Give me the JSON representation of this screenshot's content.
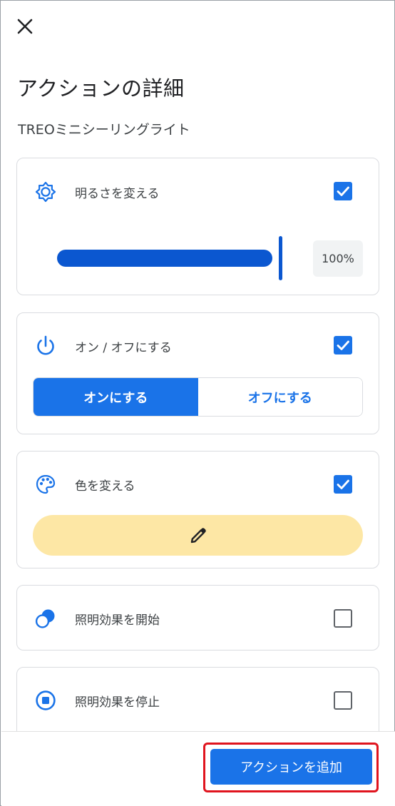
{
  "header": {
    "close_icon": "close-icon",
    "title": "アクションの詳細",
    "device": "TREOミニシーリングライト"
  },
  "actions": {
    "brightness": {
      "label": "明るさを変える",
      "icon": "brightness-icon",
      "checked": true,
      "level_percent": 100,
      "value_text": "100%"
    },
    "power": {
      "label": "オン / オフにする",
      "icon": "power-icon",
      "checked": true,
      "on_label": "オンにする",
      "off_label": "オフにする",
      "selected": "on"
    },
    "color": {
      "label": "色を変える",
      "icon": "palette-icon",
      "checked": true,
      "swatch_color": "#fde7a5",
      "edit_icon": "pencil-icon"
    },
    "start_effect": {
      "label": "照明効果を開始",
      "icon": "effect-start-icon",
      "checked": false
    },
    "stop_effect": {
      "label": "照明効果を停止",
      "icon": "stop-circle-icon",
      "checked": false
    }
  },
  "footer": {
    "add_label": "アクションを追加"
  },
  "colors": {
    "accent": "#1a73e8",
    "highlight_outline": "#e0141e"
  }
}
